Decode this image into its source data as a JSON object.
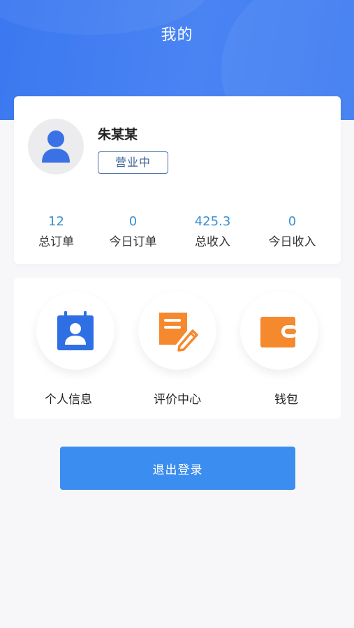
{
  "header": {
    "title": "我的"
  },
  "profile": {
    "name": "朱某某",
    "status": "营业中"
  },
  "stats": [
    {
      "value": "12",
      "label": "总订单"
    },
    {
      "value": "0",
      "label": "今日订单"
    },
    {
      "value": "425.3",
      "label": "总收入"
    },
    {
      "value": "0",
      "label": "今日收入"
    }
  ],
  "menu": [
    {
      "label": "个人信息",
      "icon": "contact-card-icon",
      "color": "#2f6fe4"
    },
    {
      "label": "评价中心",
      "icon": "edit-note-icon",
      "color": "#f5892e"
    },
    {
      "label": "钱包",
      "icon": "wallet-icon",
      "color": "#f5892e"
    }
  ],
  "logout": {
    "label": "退出登录"
  },
  "colors": {
    "header": "#3b78f0",
    "button": "#3b8df0",
    "stat_value": "#3a8fd0",
    "background": "#f7f7f9"
  }
}
